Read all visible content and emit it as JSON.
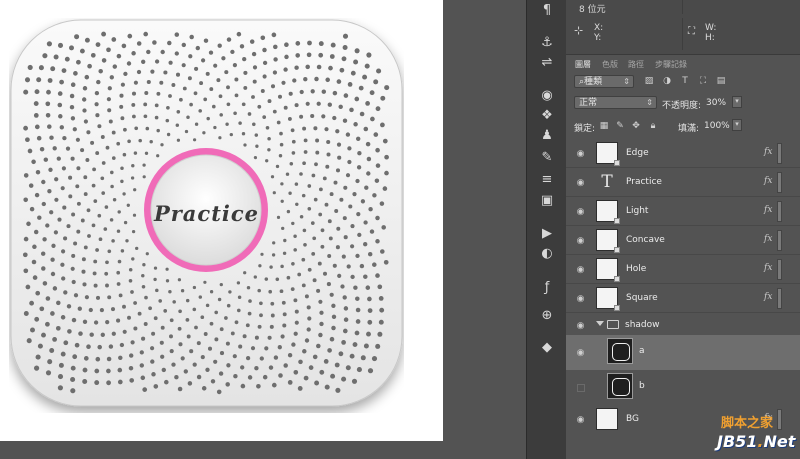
{
  "canvas": {
    "artwork_label": "Practice",
    "ring_color": "#f06bb8",
    "body_color": "#f2f2f2"
  },
  "toolbar": {
    "icons": [
      "paragraph-icon",
      "brush-settings-icon",
      "adjust-icon",
      "sphere-icon",
      "character-icon",
      "clone-icon",
      "brush-icon",
      "lines-icon",
      "image-icon",
      "play-icon",
      "mask-icon",
      "fx-icon",
      "web-icon",
      "cube-icon"
    ]
  },
  "properties": {
    "size_label": "8 位元",
    "x_label": "X:",
    "y_label": "Y:",
    "w_label": "W:",
    "h_label": "H:"
  },
  "layers_panel": {
    "tabs": [
      "圖層",
      "色版",
      "路徑",
      "步驟記錄"
    ],
    "filter_type": "種類",
    "blend_mode": "正常",
    "opacity_label": "不透明度:",
    "opacity_value": "30%",
    "lock_label": "鎖定:",
    "fill_label": "填滿:",
    "fill_value": "100%",
    "fx_label": "fx",
    "layers": [
      {
        "name": "Edge",
        "kind": "shape",
        "visible": true,
        "fx": true
      },
      {
        "name": "Practice",
        "kind": "text",
        "visible": true,
        "fx": true
      },
      {
        "name": "Light",
        "kind": "shape",
        "visible": true,
        "fx": true
      },
      {
        "name": "Concave",
        "kind": "shape",
        "visible": true,
        "fx": true
      },
      {
        "name": "Hole",
        "kind": "shape",
        "visible": true,
        "fx": true
      },
      {
        "name": "Square",
        "kind": "shape",
        "visible": true,
        "fx": true
      }
    ],
    "group": {
      "name": "shadow",
      "children": [
        {
          "name": "a",
          "visible": true,
          "selected": true
        },
        {
          "name": "b",
          "visible": false,
          "selected": false
        }
      ]
    },
    "bottom_layer": {
      "name": "BG",
      "visible": true,
      "fx": true
    }
  },
  "watermark": {
    "line1": "脚本之家",
    "line2_main": "JB51",
    "line2_dot": ".",
    "line2_end": "Net"
  }
}
